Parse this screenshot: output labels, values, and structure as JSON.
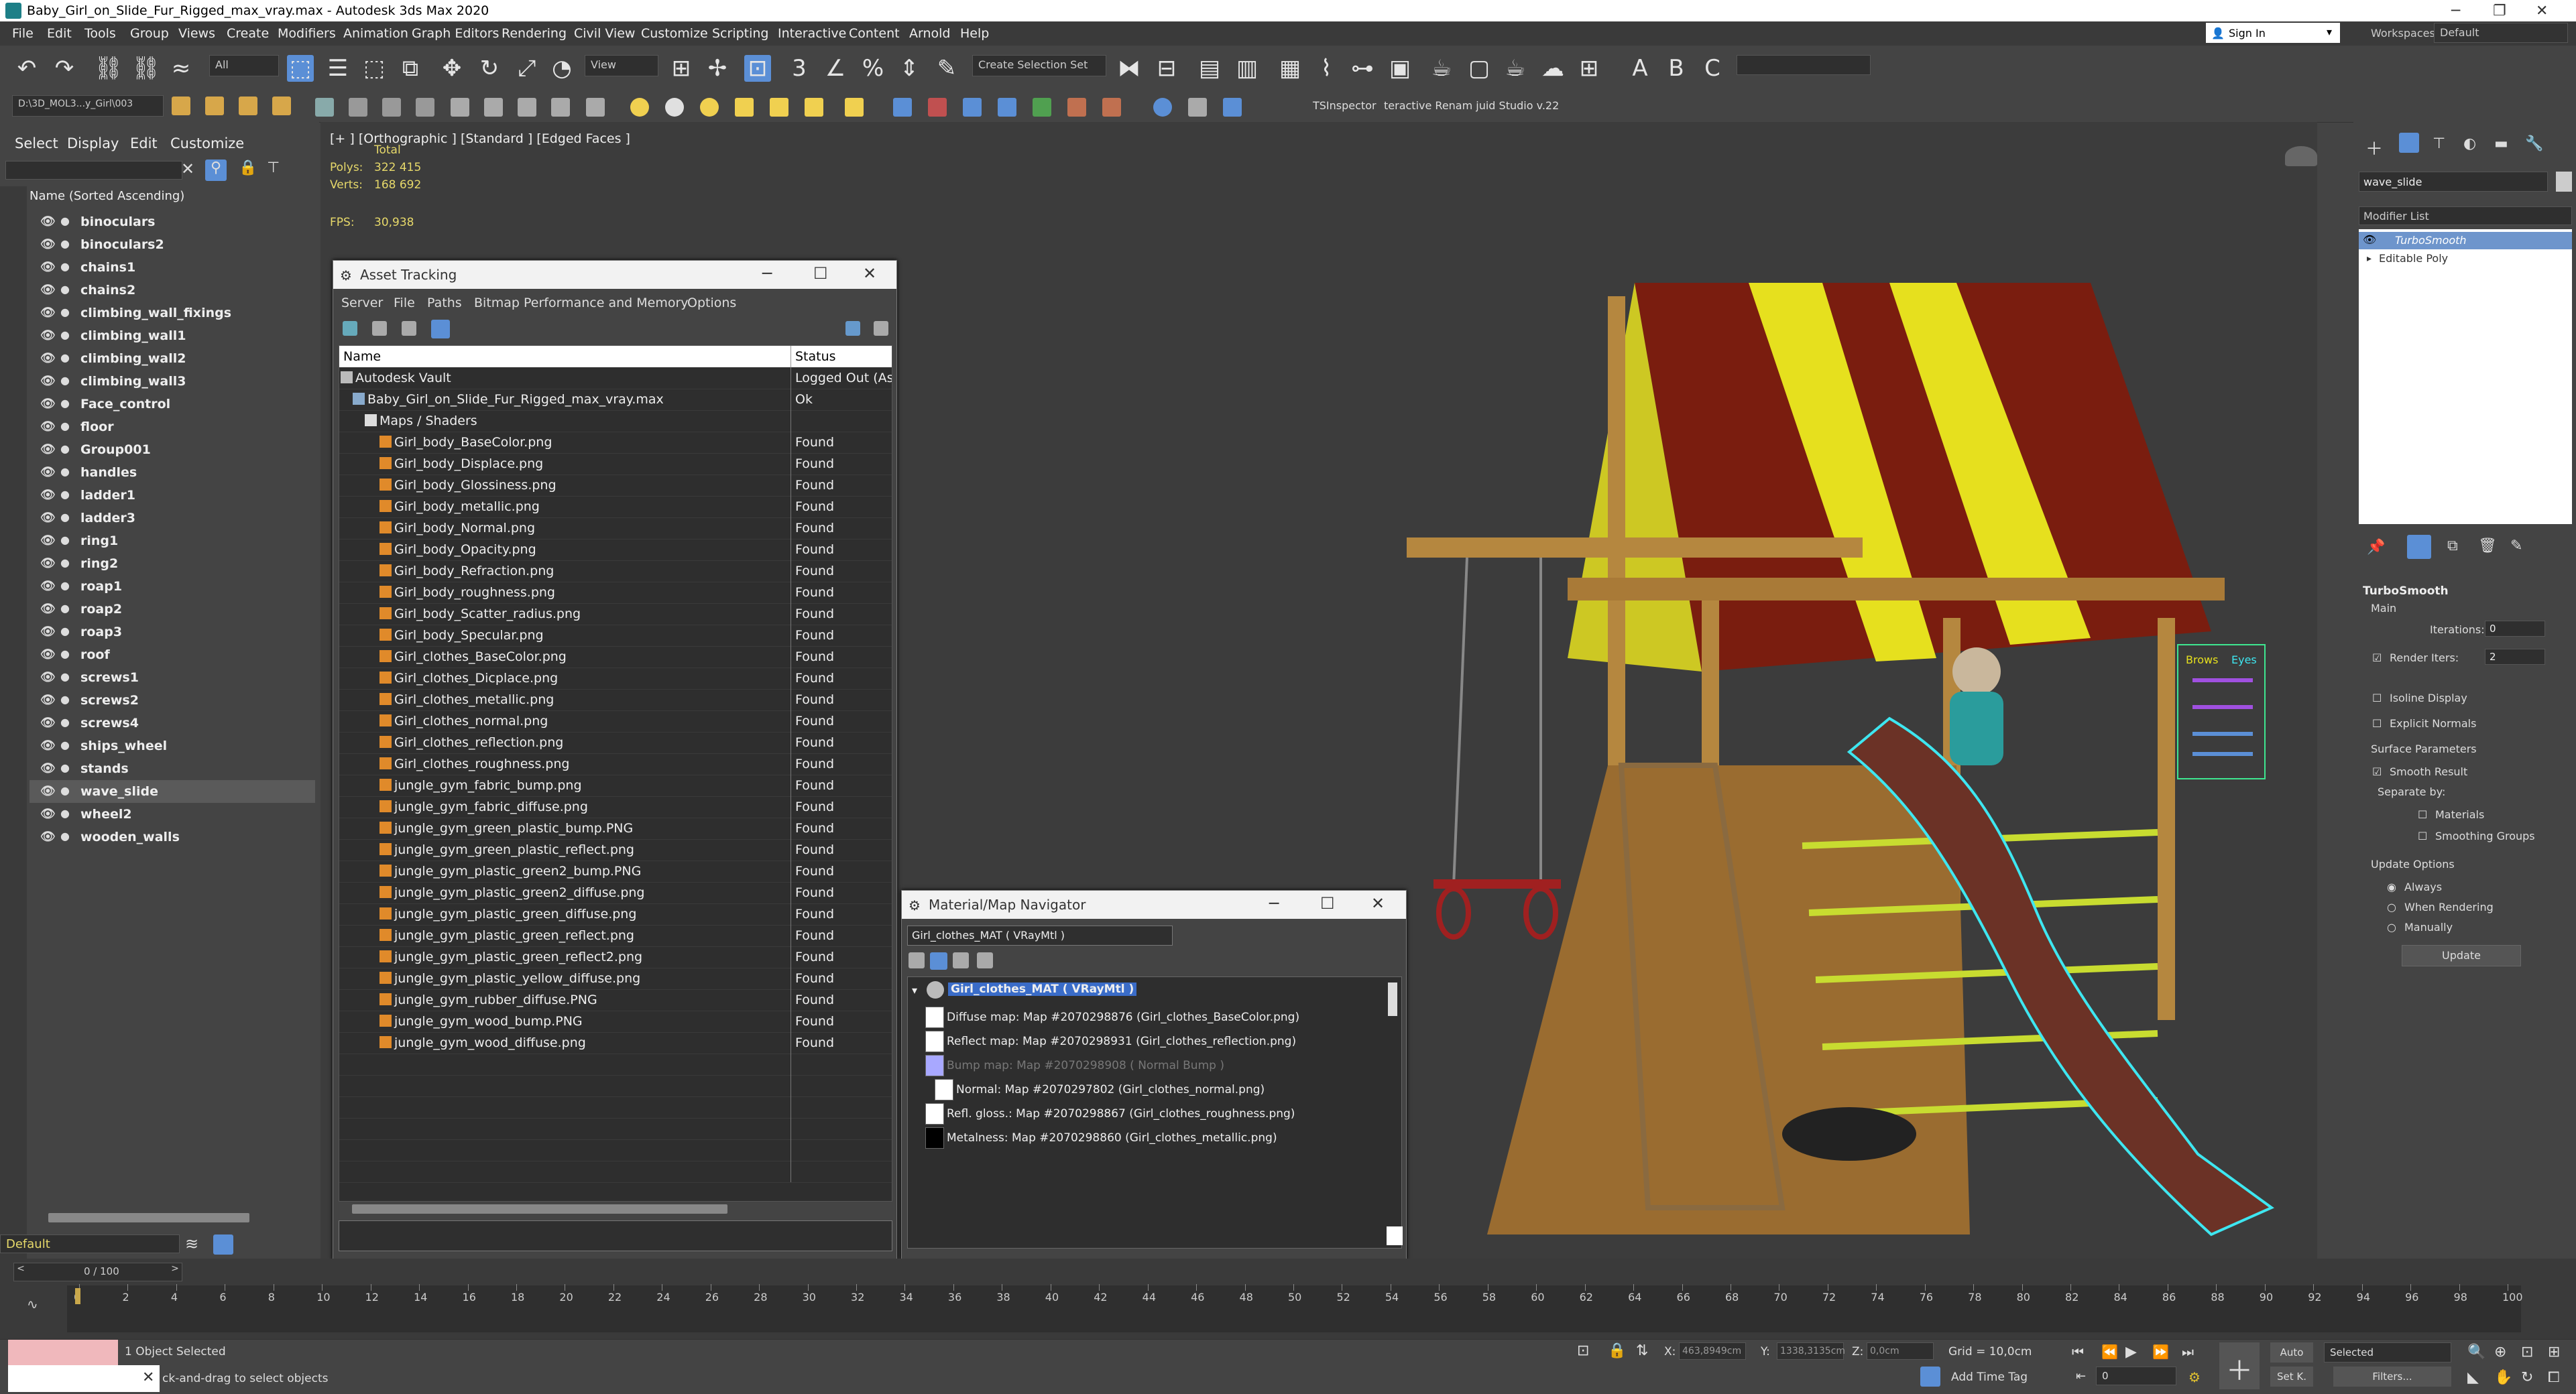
{
  "window": {
    "title": "Baby_Girl_on_Slide_Fur_Rigged_max_vray.max - Autodesk 3ds Max 2020"
  },
  "menu": [
    "File",
    "Edit",
    "Tools",
    "Group",
    "Views",
    "Create",
    "Modifiers",
    "Animation",
    "Graph Editors",
    "Rendering",
    "Civil View",
    "Customize",
    "Scripting",
    "Interactive",
    "Content",
    "Arnold",
    "Help"
  ],
  "toolbar": {
    "filter": "All",
    "view": "View",
    "selection_set": "Create Selection Set",
    "project_path": "D:\\3D_MOL3...y_Girl\\003",
    "sign_in": "Sign In",
    "workspaces_label": "Workspaces:",
    "workspace": "Default",
    "tsinspector": "TSInspector",
    "studio": "teractive Renam juid Studio v.22"
  },
  "explorer": {
    "tabs": [
      "Select",
      "Display",
      "Edit",
      "Customize"
    ],
    "header": "Name (Sorted Ascending)",
    "items": [
      {
        "name": "binoculars"
      },
      {
        "name": "binoculars2"
      },
      {
        "name": "chains1"
      },
      {
        "name": "chains2"
      },
      {
        "name": "climbing_wall_fixings"
      },
      {
        "name": "climbing_wall1"
      },
      {
        "name": "climbing_wall2"
      },
      {
        "name": "climbing_wall3"
      },
      {
        "name": "Face_control"
      },
      {
        "name": "floor"
      },
      {
        "name": "Group001"
      },
      {
        "name": "handles"
      },
      {
        "name": "ladder1"
      },
      {
        "name": "ladder3"
      },
      {
        "name": "ring1"
      },
      {
        "name": "ring2"
      },
      {
        "name": "roap1"
      },
      {
        "name": "roap2"
      },
      {
        "name": "roap3"
      },
      {
        "name": "roof"
      },
      {
        "name": "screws1"
      },
      {
        "name": "screws2"
      },
      {
        "name": "screws4"
      },
      {
        "name": "ships_wheel"
      },
      {
        "name": "stands"
      },
      {
        "name": "wave_slide",
        "selected": true
      },
      {
        "name": "wheel2"
      },
      {
        "name": "wooden_walls"
      }
    ],
    "layer": "Default"
  },
  "viewport": {
    "label": "[+ ] [Orthographic ] [Standard ] [Edged Faces ]",
    "total_label": "Total",
    "polys_label": "Polys:",
    "polys": "322 415",
    "verts_label": "Verts:",
    "verts": "168 692",
    "fps_label": "FPS:",
    "fps": "30,938",
    "ui_brows": "Brows",
    "ui_eyes": "Eyes"
  },
  "asset_tracking": {
    "title": "Asset Tracking",
    "menu": [
      "Server",
      "File",
      "Paths",
      "Bitmap Performance and Memory",
      "Options"
    ],
    "col_name": "Name",
    "col_status": "Status",
    "rows": [
      {
        "name": "Autodesk Vault",
        "status": "Logged Out (Ass"
      },
      {
        "name": "Baby_Girl_on_Slide_Fur_Rigged_max_vray.max",
        "status": "Ok"
      },
      {
        "name": "Maps / Shaders",
        "status": ""
      },
      {
        "name": "Girl_body_BaseColor.png",
        "status": "Found"
      },
      {
        "name": "Girl_body_Displace.png",
        "status": "Found"
      },
      {
        "name": "Girl_body_Glossiness.png",
        "status": "Found"
      },
      {
        "name": "Girl_body_metallic.png",
        "status": "Found"
      },
      {
        "name": "Girl_body_Normal.png",
        "status": "Found"
      },
      {
        "name": "Girl_body_Opacity.png",
        "status": "Found"
      },
      {
        "name": "Girl_body_Refraction.png",
        "status": "Found"
      },
      {
        "name": "Girl_body_roughness.png",
        "status": "Found"
      },
      {
        "name": "Girl_body_Scatter_radius.png",
        "status": "Found"
      },
      {
        "name": "Girl_body_Specular.png",
        "status": "Found"
      },
      {
        "name": "Girl_clothes_BaseColor.png",
        "status": "Found"
      },
      {
        "name": "Girl_clothes_Dicplace.png",
        "status": "Found"
      },
      {
        "name": "Girl_clothes_metallic.png",
        "status": "Found"
      },
      {
        "name": "Girl_clothes_normal.png",
        "status": "Found"
      },
      {
        "name": "Girl_clothes_reflection.png",
        "status": "Found"
      },
      {
        "name": "Girl_clothes_roughness.png",
        "status": "Found"
      },
      {
        "name": "jungle_gym_fabric_bump.png",
        "status": "Found"
      },
      {
        "name": "jungle_gym_fabric_diffuse.png",
        "status": "Found"
      },
      {
        "name": "jungle_gym_green_plastic_bump.PNG",
        "status": "Found"
      },
      {
        "name": "jungle_gym_green_plastic_reflect.png",
        "status": "Found"
      },
      {
        "name": "jungle_gym_plastic_green2_bump.PNG",
        "status": "Found"
      },
      {
        "name": "jungle_gym_plastic_green2_diffuse.png",
        "status": "Found"
      },
      {
        "name": "jungle_gym_plastic_green_diffuse.png",
        "status": "Found"
      },
      {
        "name": "jungle_gym_plastic_green_reflect.png",
        "status": "Found"
      },
      {
        "name": "jungle_gym_plastic_green_reflect2.png",
        "status": "Found"
      },
      {
        "name": "jungle_gym_plastic_yellow_diffuse.png",
        "status": "Found"
      },
      {
        "name": "jungle_gym_rubber_diffuse.PNG",
        "status": "Found"
      },
      {
        "name": "jungle_gym_wood_bump.PNG",
        "status": "Found"
      },
      {
        "name": "jungle_gym_wood_diffuse.png",
        "status": "Found"
      }
    ]
  },
  "material_navigator": {
    "title": "Material/Map Navigator",
    "current": "Girl_clothes_MAT  ( VRayMtl )",
    "root": "Girl_clothes_MAT  ( VRayMtl )",
    "maps": [
      {
        "label": "Diffuse map: Map #2070298876 (Girl_clothes_BaseColor.png)",
        "dim": false
      },
      {
        "label": "Reflect map: Map #2070298931 (Girl_clothes_reflection.png)",
        "dim": false
      },
      {
        "label": "Bump map: Map #2070298908  ( Normal Bump )",
        "dim": true
      },
      {
        "label": "Normal: Map #2070297802 (Girl_clothes_normal.png)",
        "dim": false
      },
      {
        "label": "Refl. gloss.: Map #2070298867 (Girl_clothes_roughness.png)",
        "dim": false
      },
      {
        "label": "Metalness: Map #2070298860 (Girl_clothes_metallic.png)",
        "dim": false
      }
    ]
  },
  "command_panel": {
    "object_name": "wave_slide",
    "modifier_list": "Modifier List",
    "stack": [
      "TurboSmooth",
      "Editable Poly"
    ],
    "rollout": "TurboSmooth",
    "main": "Main",
    "iterations_label": "Iterations:",
    "iterations": "0",
    "render_iters_label": "Render Iters:",
    "render_iters": "2",
    "isoline": "Isoline Display",
    "explicit_normals": "Explicit Normals",
    "surface_params": "Surface Parameters",
    "smooth_result": "Smooth Result",
    "separate_by": "Separate by:",
    "materials": "Materials",
    "smoothing_groups": "Smoothing Groups",
    "update_options": "Update Options",
    "always": "Always",
    "when_rendering": "When Rendering",
    "manually": "Manually",
    "update_btn": "Update"
  },
  "timeline": {
    "frame": "0 / 100",
    "ticks": [
      "0",
      "2",
      "4",
      "6",
      "8",
      "10",
      "12",
      "14",
      "16",
      "18",
      "20",
      "22",
      "24",
      "26",
      "28",
      "30",
      "32",
      "34",
      "36",
      "38",
      "40",
      "42",
      "44",
      "46",
      "48",
      "50",
      "52",
      "54",
      "56",
      "58",
      "60",
      "62",
      "64",
      "66",
      "68",
      "70",
      "72",
      "74",
      "76",
      "78",
      "80",
      "82",
      "84",
      "86",
      "88",
      "90",
      "92",
      "94",
      "96",
      "98",
      "100"
    ]
  },
  "status": {
    "selected": "1 Object Selected",
    "hint": "ck-and-drag to select objects",
    "x_label": "X:",
    "x": "463,8949cm",
    "y_label": "Y:",
    "y": "1338,3135cm",
    "z_label": "Z:",
    "z": "0,0cm",
    "grid": "Grid = 10,0cm",
    "add_time_tag": "Add Time Tag",
    "auto": "Auto",
    "set_k": "Set K.",
    "key_mode": "Selected",
    "filters": "Filters...",
    "frame_field": "0"
  },
  "colors": {
    "accent": "#5b8fd6",
    "viewport_bg": "#3c3c3c",
    "stats": "#e7d96a",
    "roof_red": "#7a1d0f",
    "roof_yellow": "#e6e01e",
    "wood": "#b5873f",
    "slide": "#6b3226",
    "slide_outline": "#3ee6f0"
  }
}
